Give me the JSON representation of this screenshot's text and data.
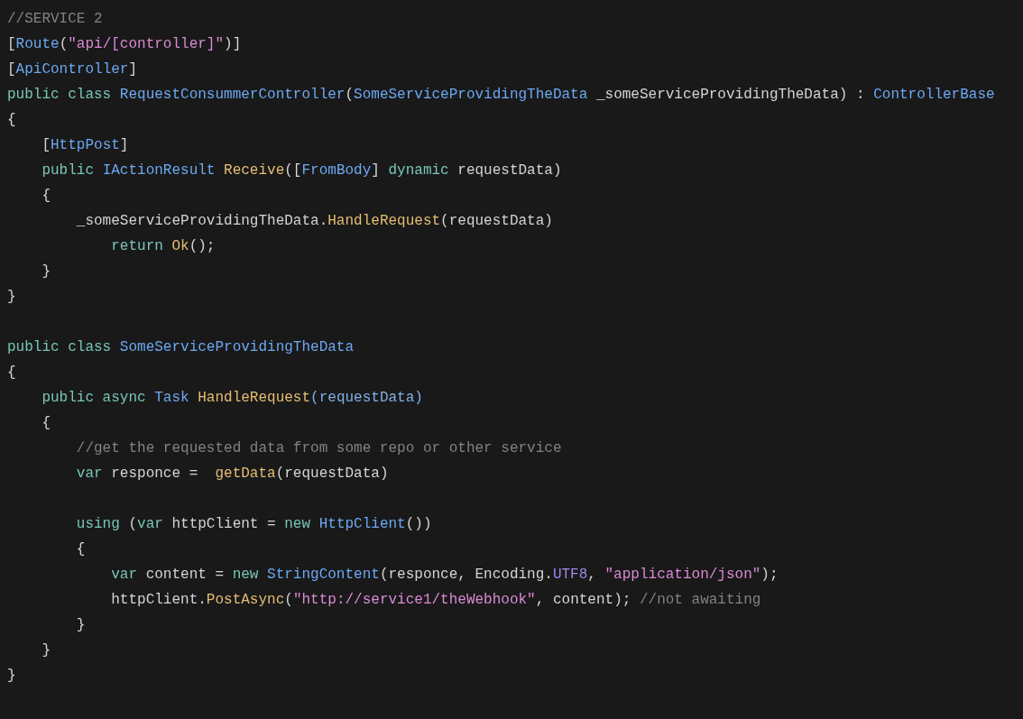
{
  "editor": {
    "lines": [
      {
        "kind": "code",
        "tokens": [
          {
            "kind": "comment",
            "text": "//SERVICE 2"
          }
        ]
      },
      {
        "kind": "code",
        "tokens": [
          {
            "kind": "plain",
            "text": "["
          },
          {
            "kind": "type",
            "text": "Route"
          },
          {
            "kind": "plain",
            "text": "("
          },
          {
            "kind": "string",
            "text": "\"api/[controller]\""
          },
          {
            "kind": "plain",
            "text": ")]"
          }
        ]
      },
      {
        "kind": "code",
        "tokens": [
          {
            "kind": "plain",
            "text": "["
          },
          {
            "kind": "type",
            "text": "ApiController"
          },
          {
            "kind": "plain",
            "text": "]"
          }
        ]
      },
      {
        "kind": "code",
        "tokens": [
          {
            "kind": "keyword",
            "text": "public class "
          },
          {
            "kind": "type",
            "text": "RequestConsummerController"
          },
          {
            "kind": "plain",
            "text": "("
          },
          {
            "kind": "type",
            "text": "SomeServiceProvidingTheData"
          },
          {
            "kind": "plain",
            "text": " _someServiceProvidingTheData) : "
          },
          {
            "kind": "type",
            "text": "ControllerBase"
          }
        ]
      },
      {
        "kind": "code",
        "tokens": [
          {
            "kind": "plain",
            "text": "{"
          }
        ]
      },
      {
        "kind": "code",
        "tokens": [
          {
            "kind": "plain",
            "text": "    ["
          },
          {
            "kind": "type",
            "text": "HttpPost"
          },
          {
            "kind": "plain",
            "text": "]"
          }
        ]
      },
      {
        "kind": "code",
        "tokens": [
          {
            "kind": "keyword",
            "text": "    public "
          },
          {
            "kind": "type",
            "text": "IActionResult "
          },
          {
            "kind": "method",
            "text": "Receive"
          },
          {
            "kind": "plain",
            "text": "(["
          },
          {
            "kind": "type",
            "text": "FromBody"
          },
          {
            "kind": "plain",
            "text": "] "
          },
          {
            "kind": "keyword",
            "text": "dynamic"
          },
          {
            "kind": "plain",
            "text": " requestData)"
          }
        ]
      },
      {
        "kind": "code",
        "tokens": [
          {
            "kind": "plain",
            "text": "    {"
          }
        ]
      },
      {
        "kind": "code",
        "tokens": [
          {
            "kind": "plain",
            "text": "        _someServiceProvidingTheData."
          },
          {
            "kind": "method",
            "text": "HandleRequest"
          },
          {
            "kind": "plain",
            "text": "(requestData)"
          }
        ]
      },
      {
        "kind": "code",
        "tokens": [
          {
            "kind": "keyword",
            "text": "            return "
          },
          {
            "kind": "method",
            "text": "Ok"
          },
          {
            "kind": "plain",
            "text": "();"
          }
        ]
      },
      {
        "kind": "code",
        "tokens": [
          {
            "kind": "plain",
            "text": "    }"
          }
        ]
      },
      {
        "kind": "code",
        "tokens": [
          {
            "kind": "plain",
            "text": "}"
          }
        ]
      },
      {
        "kind": "blank"
      },
      {
        "kind": "code",
        "tokens": [
          {
            "kind": "keyword",
            "text": "public class "
          },
          {
            "kind": "type",
            "text": "SomeServiceProvidingTheData"
          }
        ]
      },
      {
        "kind": "code",
        "tokens": [
          {
            "kind": "plain",
            "text": "{"
          }
        ]
      },
      {
        "kind": "code",
        "tokens": [
          {
            "kind": "keyword",
            "text": "    public async "
          },
          {
            "kind": "type",
            "text": "Task "
          },
          {
            "kind": "method",
            "text": "HandleRequest"
          },
          {
            "kind": "param",
            "text": "(requestData)"
          }
        ]
      },
      {
        "kind": "code",
        "tokens": [
          {
            "kind": "plain",
            "text": "    {"
          }
        ]
      },
      {
        "kind": "code",
        "tokens": [
          {
            "kind": "comment",
            "text": "        //get the requested data from some repo or other service"
          }
        ]
      },
      {
        "kind": "code",
        "tokens": [
          {
            "kind": "keyword",
            "text": "        var "
          },
          {
            "kind": "plain",
            "text": "responce =  "
          },
          {
            "kind": "method",
            "text": "getData"
          },
          {
            "kind": "plain",
            "text": "(requestData)"
          }
        ]
      },
      {
        "kind": "blank"
      },
      {
        "kind": "code",
        "tokens": [
          {
            "kind": "keyword",
            "text": "        using "
          },
          {
            "kind": "plain",
            "text": "("
          },
          {
            "kind": "keyword",
            "text": "var "
          },
          {
            "kind": "plain",
            "text": "httpClient = "
          },
          {
            "kind": "keyword",
            "text": "new "
          },
          {
            "kind": "type",
            "text": "HttpClient"
          },
          {
            "kind": "plain",
            "text": "())"
          }
        ]
      },
      {
        "kind": "code",
        "tokens": [
          {
            "kind": "plain",
            "text": "        {"
          }
        ]
      },
      {
        "kind": "code",
        "tokens": [
          {
            "kind": "keyword",
            "text": "            var "
          },
          {
            "kind": "plain",
            "text": "content = "
          },
          {
            "kind": "keyword",
            "text": "new "
          },
          {
            "kind": "type",
            "text": "StringContent"
          },
          {
            "kind": "plain",
            "text": "(responce, Encoding."
          },
          {
            "kind": "constant",
            "text": "UTF8"
          },
          {
            "kind": "plain",
            "text": ", "
          },
          {
            "kind": "string",
            "text": "\"application/json\""
          },
          {
            "kind": "plain",
            "text": ");"
          }
        ]
      },
      {
        "kind": "code",
        "tokens": [
          {
            "kind": "plain",
            "text": "            httpClient."
          },
          {
            "kind": "method",
            "text": "PostAsync"
          },
          {
            "kind": "plain",
            "text": "("
          },
          {
            "kind": "string",
            "text": "\"http://service1/theWebhook\""
          },
          {
            "kind": "plain",
            "text": ", content); "
          },
          {
            "kind": "comment",
            "text": "//not awaiting"
          }
        ]
      },
      {
        "kind": "code",
        "tokens": [
          {
            "kind": "plain",
            "text": "        }"
          }
        ]
      },
      {
        "kind": "code",
        "tokens": [
          {
            "kind": "plain",
            "text": "    }"
          }
        ]
      },
      {
        "kind": "code",
        "tokens": [
          {
            "kind": "plain",
            "text": "}"
          }
        ]
      }
    ]
  }
}
